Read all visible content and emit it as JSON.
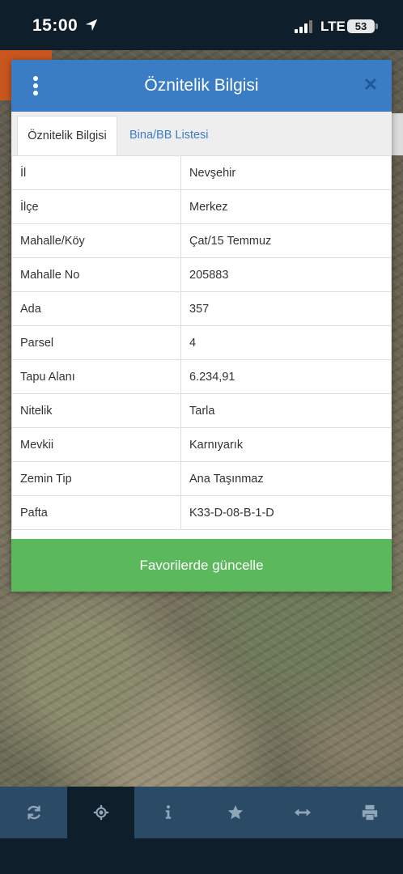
{
  "status_bar": {
    "time": "15:00",
    "network": "LTE",
    "battery": "53"
  },
  "dialog": {
    "title": "Öznitelik Bilgisi",
    "tabs": [
      {
        "label": "Öznitelik Bilgisi",
        "active": true
      },
      {
        "label": "Bina/BB Listesi",
        "active": false
      }
    ],
    "rows": [
      {
        "key": "İl",
        "value": "Nevşehir"
      },
      {
        "key": "İlçe",
        "value": "Merkez"
      },
      {
        "key": "Mahalle/Köy",
        "value": "Çat/15 Temmuz"
      },
      {
        "key": "Mahalle No",
        "value": "205883"
      },
      {
        "key": "Ada",
        "value": "357"
      },
      {
        "key": "Parsel",
        "value": "4"
      },
      {
        "key": "Tapu Alanı",
        "value": "6.234,91"
      },
      {
        "key": "Nitelik",
        "value": "Tarla"
      },
      {
        "key": "Mevkii",
        "value": "Karnıyarık"
      },
      {
        "key": "Zemin Tip",
        "value": "Ana Taşınmaz"
      },
      {
        "key": "Pafta",
        "value": "K33-D-08-B-1-D"
      }
    ],
    "favorite_button": "Favorilerde güncelle"
  },
  "toolbar": {
    "items": [
      {
        "icon": "refresh-icon",
        "active": false
      },
      {
        "icon": "locate-icon",
        "active": true
      },
      {
        "icon": "info-icon",
        "active": false
      },
      {
        "icon": "star-icon",
        "active": false
      },
      {
        "icon": "measure-icon",
        "active": false
      },
      {
        "icon": "print-icon",
        "active": false
      }
    ]
  },
  "colors": {
    "header": "#3b7dc4",
    "button_green": "#5cb85c",
    "toolbar": "#2b4a66",
    "toolbar_active": "#0f1e2b"
  }
}
